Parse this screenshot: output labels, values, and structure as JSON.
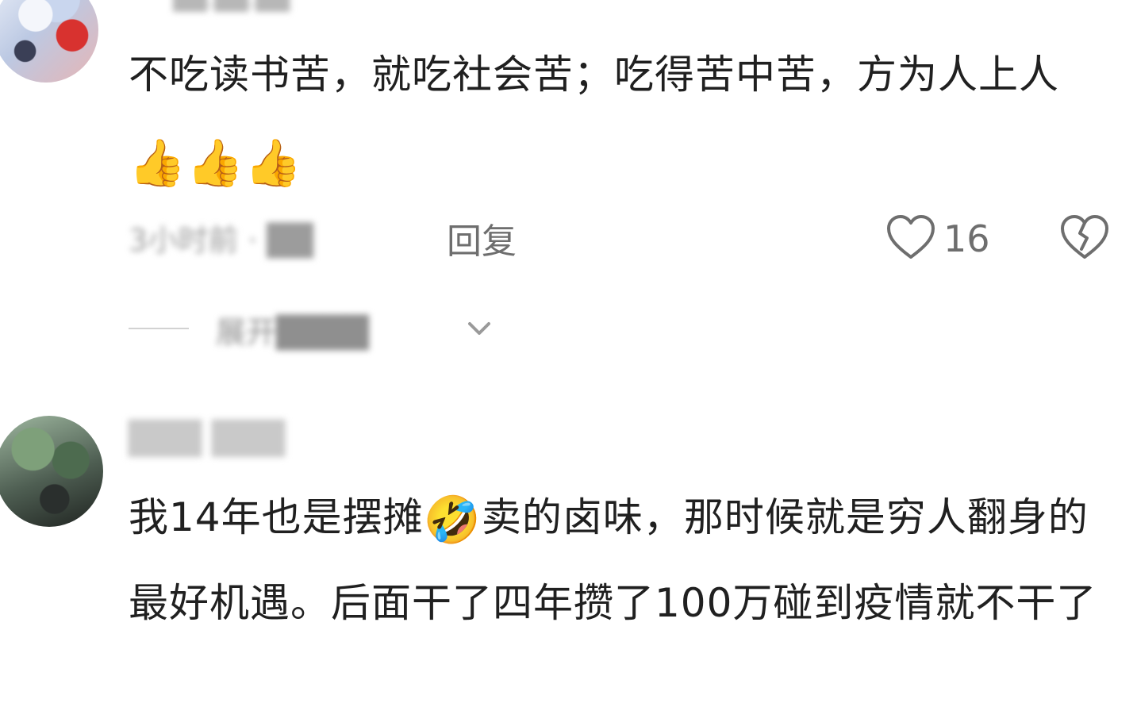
{
  "comments": [
    {
      "author_name": "██.██.██",
      "text_before_emoji": "不吃读书苦，就吃社会苦；吃得苦中苦，方为人上人",
      "emoji": "👍👍👍",
      "meta": "3小时前 · ██",
      "reply_label": "回复",
      "like_count": "16",
      "expand_label": "展开████"
    },
    {
      "author_name": "███ ███",
      "text_before_emoji": "我14年也是摆摊",
      "emoji": "🤣",
      "text_after_emoji": "卖的卤味，那时候就是穷人翻身的最好机遇。后面干了四年攒了100万碰到疫情就不干了"
    }
  ],
  "icons": {
    "like": "heart-outline-icon",
    "dislike": "broken-heart-icon",
    "expand": "chevron-down-icon"
  },
  "colors": {
    "text": "#202020",
    "muted": "#6e6e6e",
    "line": "#d2d2d2"
  }
}
